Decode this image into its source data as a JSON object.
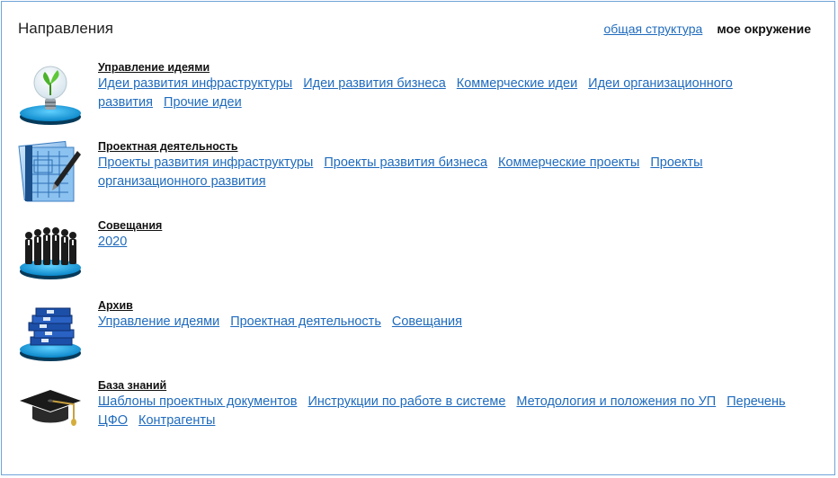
{
  "header": {
    "title": "Направления",
    "view_general": "общая структура",
    "view_mine": "мое окружение"
  },
  "sections": [
    {
      "icon": "lightbulb-plant-icon",
      "title": "Управление идеями",
      "links": [
        "Идеи развития инфраструктуры",
        "Идеи развития бизнеса",
        "Коммерческие идеи",
        "Идеи организационного развития",
        "Прочие идеи"
      ]
    },
    {
      "icon": "blueprint-pen-icon",
      "title": "Проектная деятельность",
      "links": [
        "Проекты развития инфраструктуры",
        "Проекты развития бизнеса",
        "Коммерческие проекты",
        "Проекты организационного развития"
      ]
    },
    {
      "icon": "meeting-people-icon",
      "title": "Совещания",
      "links": [
        "2020"
      ]
    },
    {
      "icon": "archive-binders-icon",
      "title": "Архив",
      "links": [
        "Управление идеями",
        "Проектная деятельность",
        "Совещания"
      ]
    },
    {
      "icon": "graduation-cap-icon",
      "title": "База знаний",
      "links": [
        "Шаблоны проектных документов",
        "Инструкции по работе в системе",
        "Методология и положения по УП",
        "Перечень ЦФО",
        "Контрагенты"
      ]
    }
  ],
  "colors": {
    "link": "#1f6bbd",
    "border": "#6fa3d9",
    "pedestal": "#1ea7e8"
  }
}
